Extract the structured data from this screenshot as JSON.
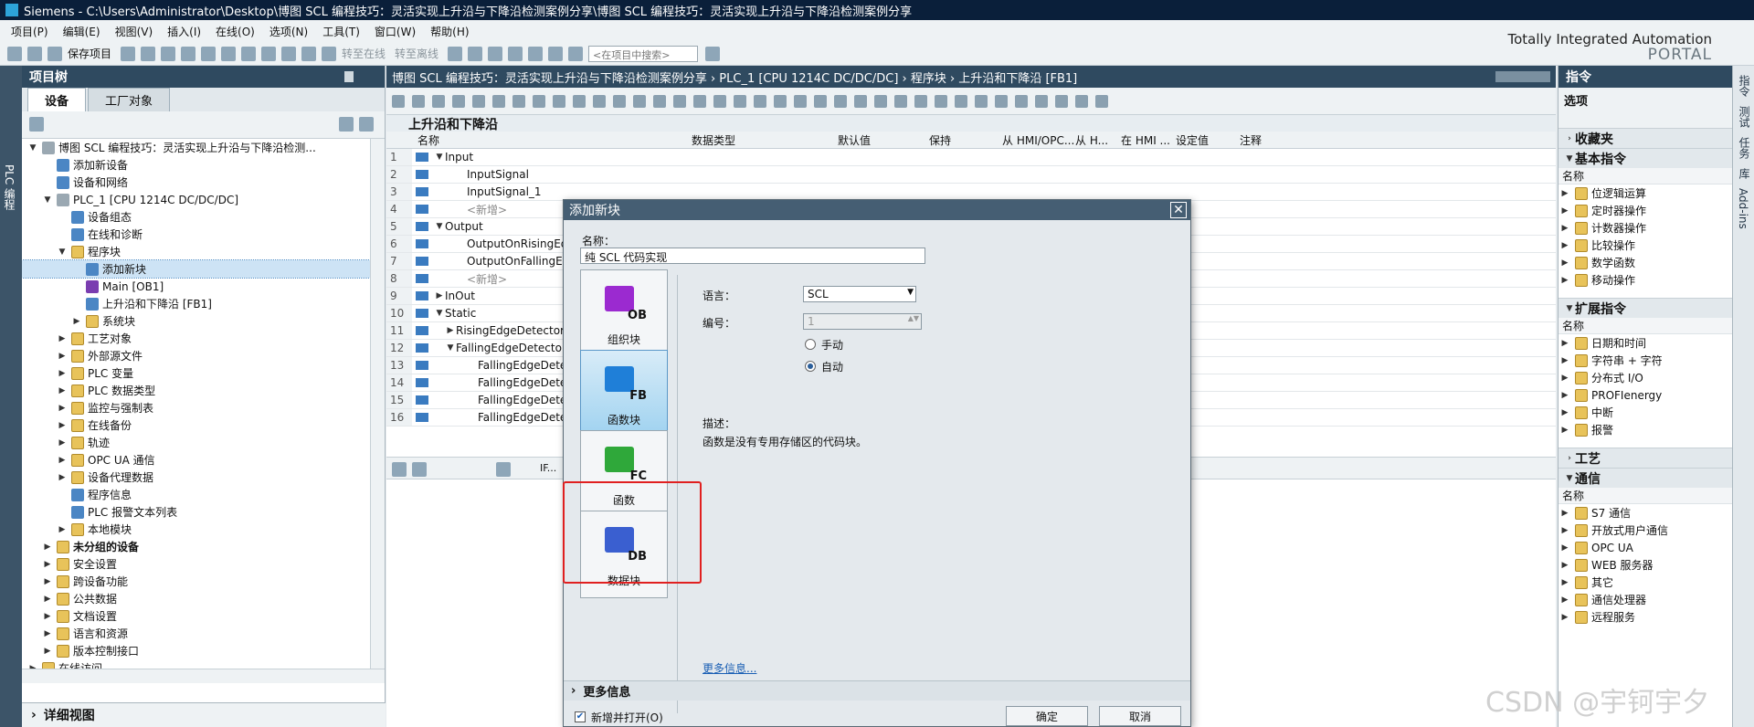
{
  "window": {
    "title": "Siemens  -  C:\\Users\\Administrator\\Desktop\\博图 SCL 编程技巧：灵活实现上升沿与下降沿检测案例分享\\博图 SCL 编程技巧：灵活实现上升沿与下降沿检测案例分享"
  },
  "menu": [
    "项目(P)",
    "编辑(E)",
    "视图(V)",
    "插入(I)",
    "在线(O)",
    "选项(N)",
    "工具(T)",
    "窗口(W)",
    "帮助(H)"
  ],
  "toolbar": {
    "save_label": "保存项目",
    "go_online": "转至在线",
    "go_offline": "转至离线",
    "search_placeholder": "<在项目中搜索>"
  },
  "brand": {
    "line1": "Totally Integrated Automation",
    "line2": "PORTAL"
  },
  "left_strip": "PLC 编程",
  "project_tree": {
    "title": "项目树",
    "tabs": [
      "设备",
      "工厂对象"
    ],
    "items": [
      {
        "label": "博图 SCL 编程技巧：灵活实现上升沿与下降沿检测...",
        "level": 0,
        "arrow": "▼",
        "icon": "gray"
      },
      {
        "label": "添加新设备",
        "level": 1,
        "arrow": "",
        "icon": "blue"
      },
      {
        "label": "设备和网络",
        "level": 1,
        "arrow": "",
        "icon": "blue"
      },
      {
        "label": "PLC_1 [CPU 1214C DC/DC/DC]",
        "level": 1,
        "arrow": "▼",
        "icon": "gray"
      },
      {
        "label": "设备组态",
        "level": 2,
        "arrow": "",
        "icon": "blue"
      },
      {
        "label": "在线和诊断",
        "level": 2,
        "arrow": "",
        "icon": "blue"
      },
      {
        "label": "程序块",
        "level": 2,
        "arrow": "▼",
        "icon": "folder"
      },
      {
        "label": "添加新块",
        "level": 3,
        "arrow": "",
        "icon": "blue",
        "selected": true
      },
      {
        "label": "Main [OB1]",
        "level": 3,
        "arrow": "",
        "icon": "purple"
      },
      {
        "label": "上升沿和下降沿 [FB1]",
        "level": 3,
        "arrow": "",
        "icon": "blue"
      },
      {
        "label": "系统块",
        "level": 3,
        "arrow": "▶",
        "icon": "folder"
      },
      {
        "label": "工艺对象",
        "level": 2,
        "arrow": "▶",
        "icon": "folder"
      },
      {
        "label": "外部源文件",
        "level": 2,
        "arrow": "▶",
        "icon": "folder"
      },
      {
        "label": "PLC 变量",
        "level": 2,
        "arrow": "▶",
        "icon": "folder"
      },
      {
        "label": "PLC 数据类型",
        "level": 2,
        "arrow": "▶",
        "icon": "folder"
      },
      {
        "label": "监控与强制表",
        "level": 2,
        "arrow": "▶",
        "icon": "folder"
      },
      {
        "label": "在线备份",
        "level": 2,
        "arrow": "▶",
        "icon": "folder"
      },
      {
        "label": "轨迹",
        "level": 2,
        "arrow": "▶",
        "icon": "folder"
      },
      {
        "label": "OPC UA 通信",
        "level": 2,
        "arrow": "▶",
        "icon": "folder"
      },
      {
        "label": "设备代理数据",
        "level": 2,
        "arrow": "▶",
        "icon": "folder"
      },
      {
        "label": "程序信息",
        "level": 2,
        "arrow": "",
        "icon": "blue"
      },
      {
        "label": "PLC 报警文本列表",
        "level": 2,
        "arrow": "",
        "icon": "blue"
      },
      {
        "label": "本地模块",
        "level": 2,
        "arrow": "▶",
        "icon": "folder"
      },
      {
        "label": "未分组的设备",
        "level": 1,
        "arrow": "▶",
        "icon": "folder",
        "bold": true
      },
      {
        "label": "安全设置",
        "level": 1,
        "arrow": "▶",
        "icon": "folder"
      },
      {
        "label": "跨设备功能",
        "level": 1,
        "arrow": "▶",
        "icon": "folder"
      },
      {
        "label": "公共数据",
        "level": 1,
        "arrow": "▶",
        "icon": "folder"
      },
      {
        "label": "文档设置",
        "level": 1,
        "arrow": "▶",
        "icon": "folder"
      },
      {
        "label": "语言和资源",
        "level": 1,
        "arrow": "▶",
        "icon": "folder"
      },
      {
        "label": "版本控制接口",
        "level": 1,
        "arrow": "▶",
        "icon": "folder"
      },
      {
        "label": "在线访问",
        "level": 0,
        "arrow": "▶",
        "icon": "folder"
      }
    ],
    "detail_view": "详细视图"
  },
  "editor": {
    "breadcrumb": "博图 SCL 编程技巧：灵活实现上升沿与下降沿检测案例分享  ›  PLC_1 [CPU 1214C DC/DC/DC]  ›  程序块  ›  上升沿和下降沿 [FB1]",
    "block_title": "上升沿和下降沿",
    "columns": [
      "名称",
      "数据类型",
      "默认值",
      "保持",
      "从 HMI/OPC...",
      "从 H...",
      "在 HMI ...",
      "设定值",
      "注释"
    ],
    "rows": [
      {
        "n": "1",
        "name": "Input",
        "arrow": "▼",
        "indent": 0
      },
      {
        "n": "2",
        "name": "InputSignal",
        "arrow": "",
        "indent": 2
      },
      {
        "n": "3",
        "name": "InputSignal_1",
        "arrow": "",
        "indent": 2
      },
      {
        "n": "4",
        "name": "<新增>",
        "arrow": "",
        "indent": 2
      },
      {
        "n": "5",
        "name": "Output",
        "arrow": "▼",
        "indent": 0
      },
      {
        "n": "6",
        "name": "OutputOnRisingEdg",
        "arrow": "",
        "indent": 2
      },
      {
        "n": "7",
        "name": "OutputOnFallingEd",
        "arrow": "",
        "indent": 2
      },
      {
        "n": "8",
        "name": "<新增>",
        "arrow": "",
        "indent": 2
      },
      {
        "n": "9",
        "name": "InOut",
        "arrow": "▶",
        "indent": 0
      },
      {
        "n": "10",
        "name": "Static",
        "arrow": "▼",
        "indent": 0
      },
      {
        "n": "11",
        "name": "RisingEdgeDetector",
        "arrow": "▶",
        "indent": 1
      },
      {
        "n": "12",
        "name": "FallingEdgeDetecto",
        "arrow": "▼",
        "indent": 1
      },
      {
        "n": "13",
        "name": "FallingEdgeDete",
        "arrow": "",
        "indent": 3
      },
      {
        "n": "14",
        "name": "FallingEdgeDete",
        "arrow": "",
        "indent": 3
      },
      {
        "n": "15",
        "name": "FallingEdgeDete",
        "arrow": "",
        "indent": 3
      },
      {
        "n": "16",
        "name": "FallingEdgeDete",
        "arrow": "",
        "indent": 3
      }
    ],
    "tab_stub": "IF..."
  },
  "dialog": {
    "title": "添加新块",
    "name_label": "名称：",
    "name_value": "纯 SCL 代码实现",
    "blocks": [
      {
        "label": "组织块",
        "code": "OB",
        "color": "#9b2ad0"
      },
      {
        "label": "函数块",
        "code": "FB",
        "color": "#1f7fd8",
        "selected": true
      },
      {
        "label": "函数",
        "code": "FC",
        "color": "#2fa83a"
      },
      {
        "label": "数据块",
        "code": "DB",
        "color": "#3a5fd0"
      }
    ],
    "language_label": "语言：",
    "language_value": "SCL",
    "number_label": "编号：",
    "number_value": "1",
    "radio_manual": "手动",
    "radio_auto": "自动",
    "desc_label": "描述：",
    "desc_text": "函数是没有专用存储区的代码块。",
    "more_link": "更多信息...",
    "more_section": "更多信息",
    "open_checkbox": "新增并打开(O)",
    "ok": "确定",
    "cancel": "取消"
  },
  "instructions": {
    "title": "指令",
    "options": "选项",
    "favorites": "收藏夹",
    "basic": "基本指令",
    "col_name": "名称",
    "basic_items": [
      "位逻辑运算",
      "定时器操作",
      "计数器操作",
      "比较操作",
      "数学函数",
      "移动操作"
    ],
    "extended": "扩展指令",
    "extended_items": [
      "日期和时间",
      "字符串 + 字符",
      "分布式 I/O",
      "PROFIenergy",
      "中断",
      "报警"
    ],
    "tech": "工艺",
    "comm": "通信",
    "comm_items": [
      "S7 通信",
      "开放式用户通信",
      "OPC UA",
      "WEB 服务器",
      "其它",
      "通信处理器",
      "远程服务"
    ]
  },
  "right_tabs": [
    "指令",
    "测试",
    "任务",
    "库",
    "Add-ins"
  ],
  "watermark": "CSDN @宇钶宇夕"
}
